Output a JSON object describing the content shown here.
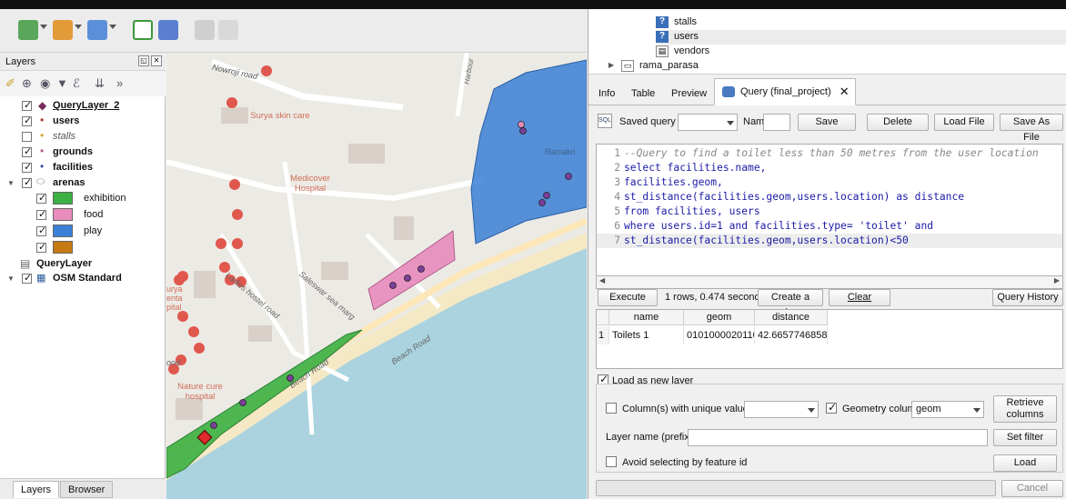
{
  "layers_panel": {
    "title": "Layers",
    "tree": [
      {
        "label": "QueryLayer_2",
        "checked": true,
        "bold": true,
        "underline": true
      },
      {
        "label": "users",
        "checked": true,
        "bold": true
      },
      {
        "label": "stalls",
        "checked": false,
        "italic": true
      },
      {
        "label": "grounds",
        "checked": true,
        "bold": true
      },
      {
        "label": "facilities",
        "checked": true,
        "bold": true
      },
      {
        "label": "arenas",
        "checked": true,
        "bold": true
      },
      {
        "label": "exhibition",
        "checked": true,
        "color": "#3cb043"
      },
      {
        "label": "food",
        "checked": true,
        "color": "#e88bbd"
      },
      {
        "label": "play",
        "checked": true,
        "color": "#3b7fd6"
      },
      {
        "label": "",
        "checked": true,
        "color": "#c77a13"
      },
      {
        "label": "QueryLayer",
        "checked": null,
        "bold": true
      },
      {
        "label": "OSM Standard",
        "checked": true,
        "bold": true
      }
    ],
    "bottom_tabs": [
      "Layers",
      "Browser"
    ]
  },
  "map": {
    "labels": [
      "Nowroji road",
      "Surya skin care",
      "Medicover Hospital",
      "Beach Road",
      "Beach Road",
      "Ladies hostel road",
      "Saleswar sea marg",
      "Nature cure hospital",
      "Harbour",
      "Ramakri",
      "urya enta pital",
      "ood"
    ]
  },
  "db_tree": {
    "items": [
      {
        "label": "stalls",
        "icon": "question-table-icon"
      },
      {
        "label": "users",
        "icon": "question-table-icon"
      },
      {
        "label": "vendors",
        "icon": "table-icon"
      },
      {
        "label": "rama_parasa",
        "icon": "schema-icon"
      }
    ]
  },
  "tabs": [
    "Info",
    "Table",
    "Preview",
    "Query (final_project)"
  ],
  "query": {
    "saved_query_label": "Saved query",
    "name_label": "Name",
    "buttons": {
      "save": "Save",
      "delete": "Delete",
      "load_file": "Load File",
      "save_as_file": "Save As File"
    },
    "code_lines": [
      "--Query to find a toilet less than 50 metres from the user location",
      "select facilities.name,",
      "facilities.geom,",
      "st_distance(facilities.geom,users.location) as distance",
      "from facilities, users",
      "where users.id=1 and facilities.type= 'toilet' and",
      "st_distance(facilities.geom,users.location)<50"
    ],
    "execute_label": "Execute",
    "status": "1 rows, 0.474 seconds",
    "create_view_label": "Create a view",
    "clear_label": "Clear",
    "history_label": "Query History",
    "results": {
      "columns": [
        "name",
        "geom",
        "distance"
      ],
      "rows": [
        {
          "index": "1",
          "name": "Toilets 1",
          "geom": "0101000020110...",
          "distance": "42.66577468581..."
        }
      ]
    },
    "load_as_layer_label": "Load as new layer",
    "unique_col_label": "Column(s) with unique values",
    "geometry_col_label": "Geometry column",
    "geometry_col_value": "geom",
    "retrieve_label": "Retrieve columns",
    "layer_name_label": "Layer name (prefix)",
    "set_filter_label": "Set filter",
    "avoid_label": "Avoid selecting by feature id",
    "load_label": "Load",
    "cancel_label": "Cancel"
  }
}
